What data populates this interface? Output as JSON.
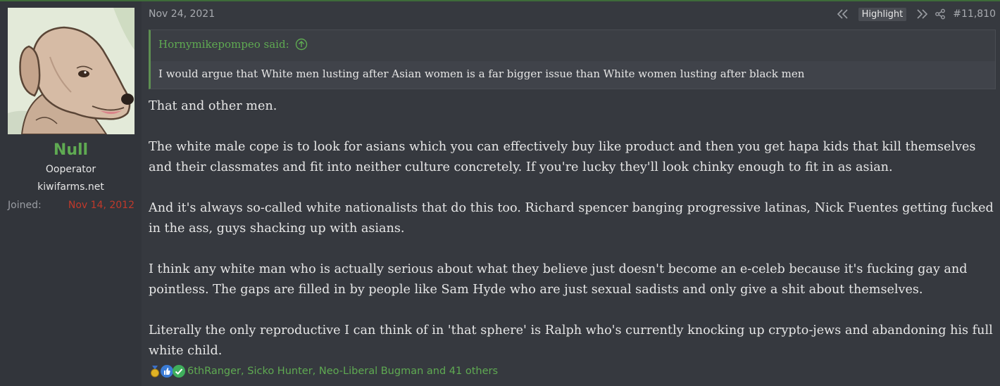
{
  "user": {
    "name": "Null",
    "title": "Ooperator",
    "site": "kiwifarms.net",
    "joined_label": "Joined:",
    "joined_date": "Nov 14, 2012",
    "avatar_icon": "dog-avatar-icon"
  },
  "post": {
    "date": "Nov 24, 2021",
    "highlight_label": "Highlight",
    "number": "#11,810",
    "icons": {
      "prev": "rewind-icon",
      "next": "fast-forward-icon",
      "share": "share-icon"
    }
  },
  "quote": {
    "author": "Hornymikepompeo said:",
    "text": "I would argue that White men lusting after Asian women is a far bigger issue than White women lusting after black men"
  },
  "message": {
    "paragraphs": [
      "That and other men.",
      "The white male cope is to look for asians which you can effectively buy like product and then you get hapa kids that kill themselves and their classmates and fit into neither culture concretely. If you're lucky they'll look chinky enough to fit in as asian.",
      "And it's always so-called white nationalists that do this too. Richard spencer banging progressive latinas, Nick Fuentes getting fucked in the ass, guys shacking up with asians.",
      "I think any white man who is actually serious about what they believe just doesn't become an e-celeb because it's fucking gay and pointless. The gaps are filled in by people like Sam Hyde who are just sexual sadists and only give a shit about themselves.",
      "Literally the only reproductive I can think of in 'that sphere' is Ralph who's currently knocking up crypto-jews and abandoning his full white child."
    ]
  },
  "reactions": {
    "icons": [
      "medal-icon",
      "thumbs-up-icon",
      "check-icon"
    ],
    "text": "6thRanger, Sicko Hunter, Neo-Liberal Bugman and 41 others"
  },
  "colors": {
    "accent_green": "#5faa52",
    "joined_red": "#c0392b",
    "background": "#36393f",
    "sidebar": "#32353b"
  }
}
